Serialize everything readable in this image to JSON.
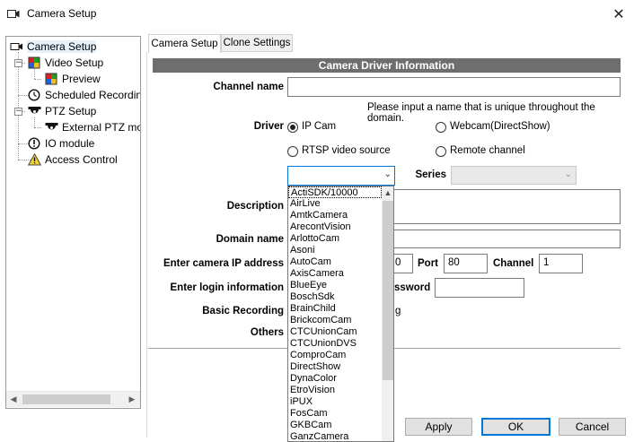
{
  "window": {
    "title": "Camera Setup",
    "close_glyph": "✕"
  },
  "tree": {
    "items": [
      {
        "label": "Camera Setup",
        "icon": "camera-icon"
      },
      {
        "label": "Video Setup",
        "icon": "color-grid-icon",
        "expander": "−"
      },
      {
        "label": "Preview",
        "icon": "color-grid-icon"
      },
      {
        "label": "Scheduled Recording",
        "icon": "clock-icon"
      },
      {
        "label": "PTZ Setup",
        "icon": "ptz-dome-icon",
        "expander": "−"
      },
      {
        "label": "External PTZ mod",
        "icon": "ptz-dome-icon"
      },
      {
        "label": "IO module",
        "icon": "alert-circle-icon"
      },
      {
        "label": "Access Control",
        "icon": "warning-icon"
      }
    ],
    "scroll_left": "◀",
    "scroll_right": "▶"
  },
  "tabs": [
    {
      "label": "Camera Setup",
      "active": true
    },
    {
      "label": "Clone Settings",
      "active": false
    }
  ],
  "form": {
    "section_title": "Camera Driver Information",
    "channel_name_label": "Channel name",
    "channel_name_value": "",
    "hint": "Please input a name that is unique throughout the domain.",
    "driver_label": "Driver",
    "driver_options": [
      {
        "label": "IP Cam",
        "checked": true
      },
      {
        "label": "Webcam(DirectShow)",
        "checked": false
      },
      {
        "label": "RTSP video source",
        "checked": false
      },
      {
        "label": "Remote channel",
        "checked": false
      }
    ],
    "driver_combo_value": "",
    "combo_arrow": "⌄",
    "series_label": "Series",
    "series_value": "",
    "description_label": "Description",
    "domain_name_label": "Domain name",
    "camera_ip_label": "Enter camera IP address",
    "ip_partial": "0",
    "port_label": "Port",
    "port_value": "80",
    "channel_label": "Channel",
    "channel_value": "1",
    "login_label": "Enter login information",
    "password_partial": "ssword",
    "basic_recording_label": "Basic Recording",
    "basic_recording_partial": "g",
    "others_label": "Others"
  },
  "dropdown": {
    "items": [
      "ActiSDK/10000",
      "AirLive",
      "AmtkCamera",
      "ArecontVision",
      "ArlottoCam",
      "Asoni",
      "AutoCam",
      "AxisCamera",
      "BlueEye",
      "BoschSdk",
      "BrainChild",
      "BrickcomCam",
      "CTCUnionCam",
      "CTCUnionDVS",
      "ComproCam",
      "DirectShow",
      "DynaColor",
      "EtroVision",
      "iPUX",
      "FosCam",
      "GKBCam",
      "GanzCamera"
    ],
    "scroll_up": "▲"
  },
  "buttons": {
    "apply": "Apply",
    "ok": "OK",
    "cancel": "Cancel"
  }
}
